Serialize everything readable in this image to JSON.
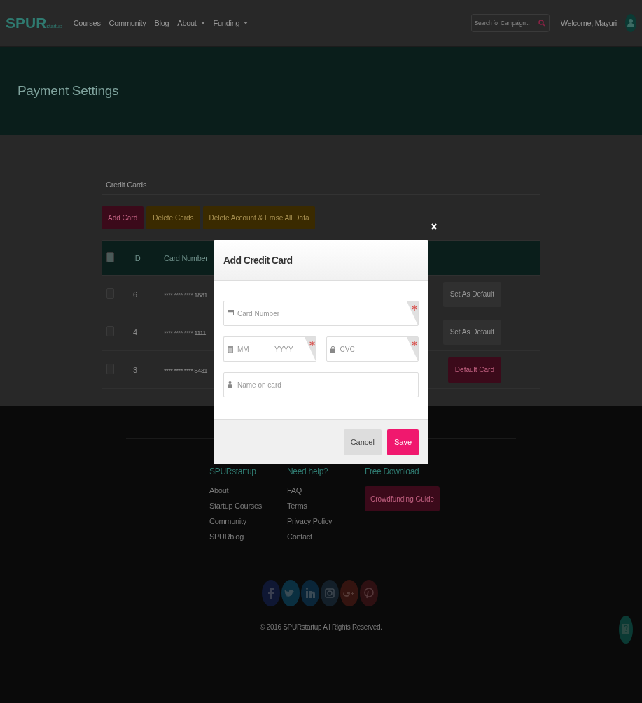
{
  "navbar": {
    "logo": {
      "main": "SPUR",
      "sub": "startup"
    },
    "links": [
      {
        "label": "Courses",
        "has_menu": false
      },
      {
        "label": "Community",
        "has_menu": false
      },
      {
        "label": "Blog",
        "has_menu": false
      },
      {
        "label": "About",
        "has_menu": true
      },
      {
        "label": "Funding",
        "has_menu": true
      }
    ],
    "search": {
      "placeholder": "Search for Campaign..."
    },
    "welcome": "Welcome, Mayuri"
  },
  "header": {
    "title": "Payment Settings"
  },
  "section_tab": "Credit Cards",
  "actions": [
    {
      "label": "Add Card",
      "kind": "primary"
    },
    {
      "label": "Delete Cards",
      "kind": "warning"
    },
    {
      "label": "Delete Account & Erase All Data",
      "kind": "warning"
    }
  ],
  "table": {
    "columns": [
      "ID",
      "Card Number"
    ],
    "header_checked": false,
    "rows": [
      {
        "id": "6",
        "number": "**** **** **** 1881",
        "checked": false,
        "action": "Set As Default",
        "is_default": false
      },
      {
        "id": "4",
        "number": "**** **** **** 1111",
        "checked": false,
        "action": "Set As Default",
        "is_default": false
      },
      {
        "id": "3",
        "number": "**** **** **** 8431",
        "checked": false,
        "action": "Default Card",
        "is_default": true
      }
    ]
  },
  "footer": {
    "columns": [
      {
        "heading": "SPURstartup",
        "links": [
          "About",
          "Startup Courses",
          "Community",
          "SPURblog"
        ]
      },
      {
        "heading": "Need help?",
        "links": [
          "FAQ",
          "Terms",
          "Privacy Policy",
          "Contact"
        ]
      },
      {
        "heading": "Free Download",
        "button": "Crowdfunding Guide"
      }
    ],
    "social": [
      {
        "kind": "facebook",
        "color": "#0f1733"
      },
      {
        "kind": "twitter",
        "color": "#0a2f40"
      },
      {
        "kind": "linkedin",
        "color": "#0a2538"
      },
      {
        "kind": "instagram",
        "color": "#131f29"
      },
      {
        "kind": "google",
        "color": "#341410"
      },
      {
        "kind": "pinterest",
        "color": "#2e1012"
      }
    ],
    "copyright": "© 2016 SPURstartup All Rights Reserved."
  },
  "modal": {
    "title": "Add Credit Card",
    "fields": [
      {
        "kind": "card",
        "placeholder": "Card Number",
        "required": true
      },
      {
        "kind": "expiry",
        "placeholder": "MM",
        "placeholder_2": "YYYY",
        "required": true
      },
      {
        "kind": "cvc",
        "placeholder": "CVC",
        "required": true
      },
      {
        "kind": "name",
        "placeholder": "Name on card",
        "required": false
      }
    ],
    "buttons": [
      {
        "label": "Cancel",
        "kind": "secondary"
      },
      {
        "label": "Save",
        "kind": "primary"
      }
    ]
  }
}
